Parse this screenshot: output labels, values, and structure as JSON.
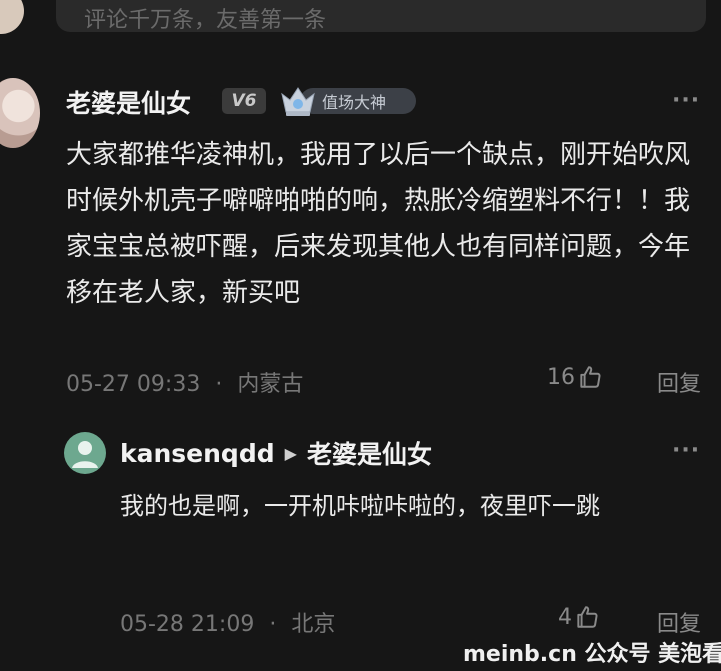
{
  "input": {
    "placeholder": "评论千万条，友善第一条"
  },
  "comment": {
    "username": "老婆是仙女",
    "level": "V6",
    "title": "值场大神",
    "text": "大家都推华凌神机，我用了以后一个缺点，刚开始吹风时候外机壳子噼噼啪啪的响，热胀冷缩塑料不行！！我家宝宝总被吓醒，后来发现其他人也有同样问题，今年移在老人家，新买吧",
    "time": "05-27 09:33",
    "location": "内蒙古",
    "meta_sep": "·",
    "likes": "16",
    "reply_label": "回复",
    "more": "···"
  },
  "reply": {
    "username": "kansenqdd",
    "reply_to": "老婆是仙女",
    "arrow": "▶",
    "text": "我的也是啊，一开机咔啦咔啦的，夜里吓一跳",
    "time": "05-28 21:09",
    "location": "北京",
    "meta_sep": "·",
    "likes": "4",
    "reply_label": "回复",
    "more": "···"
  },
  "watermark": "meinb.cn  公众号 美泡看"
}
